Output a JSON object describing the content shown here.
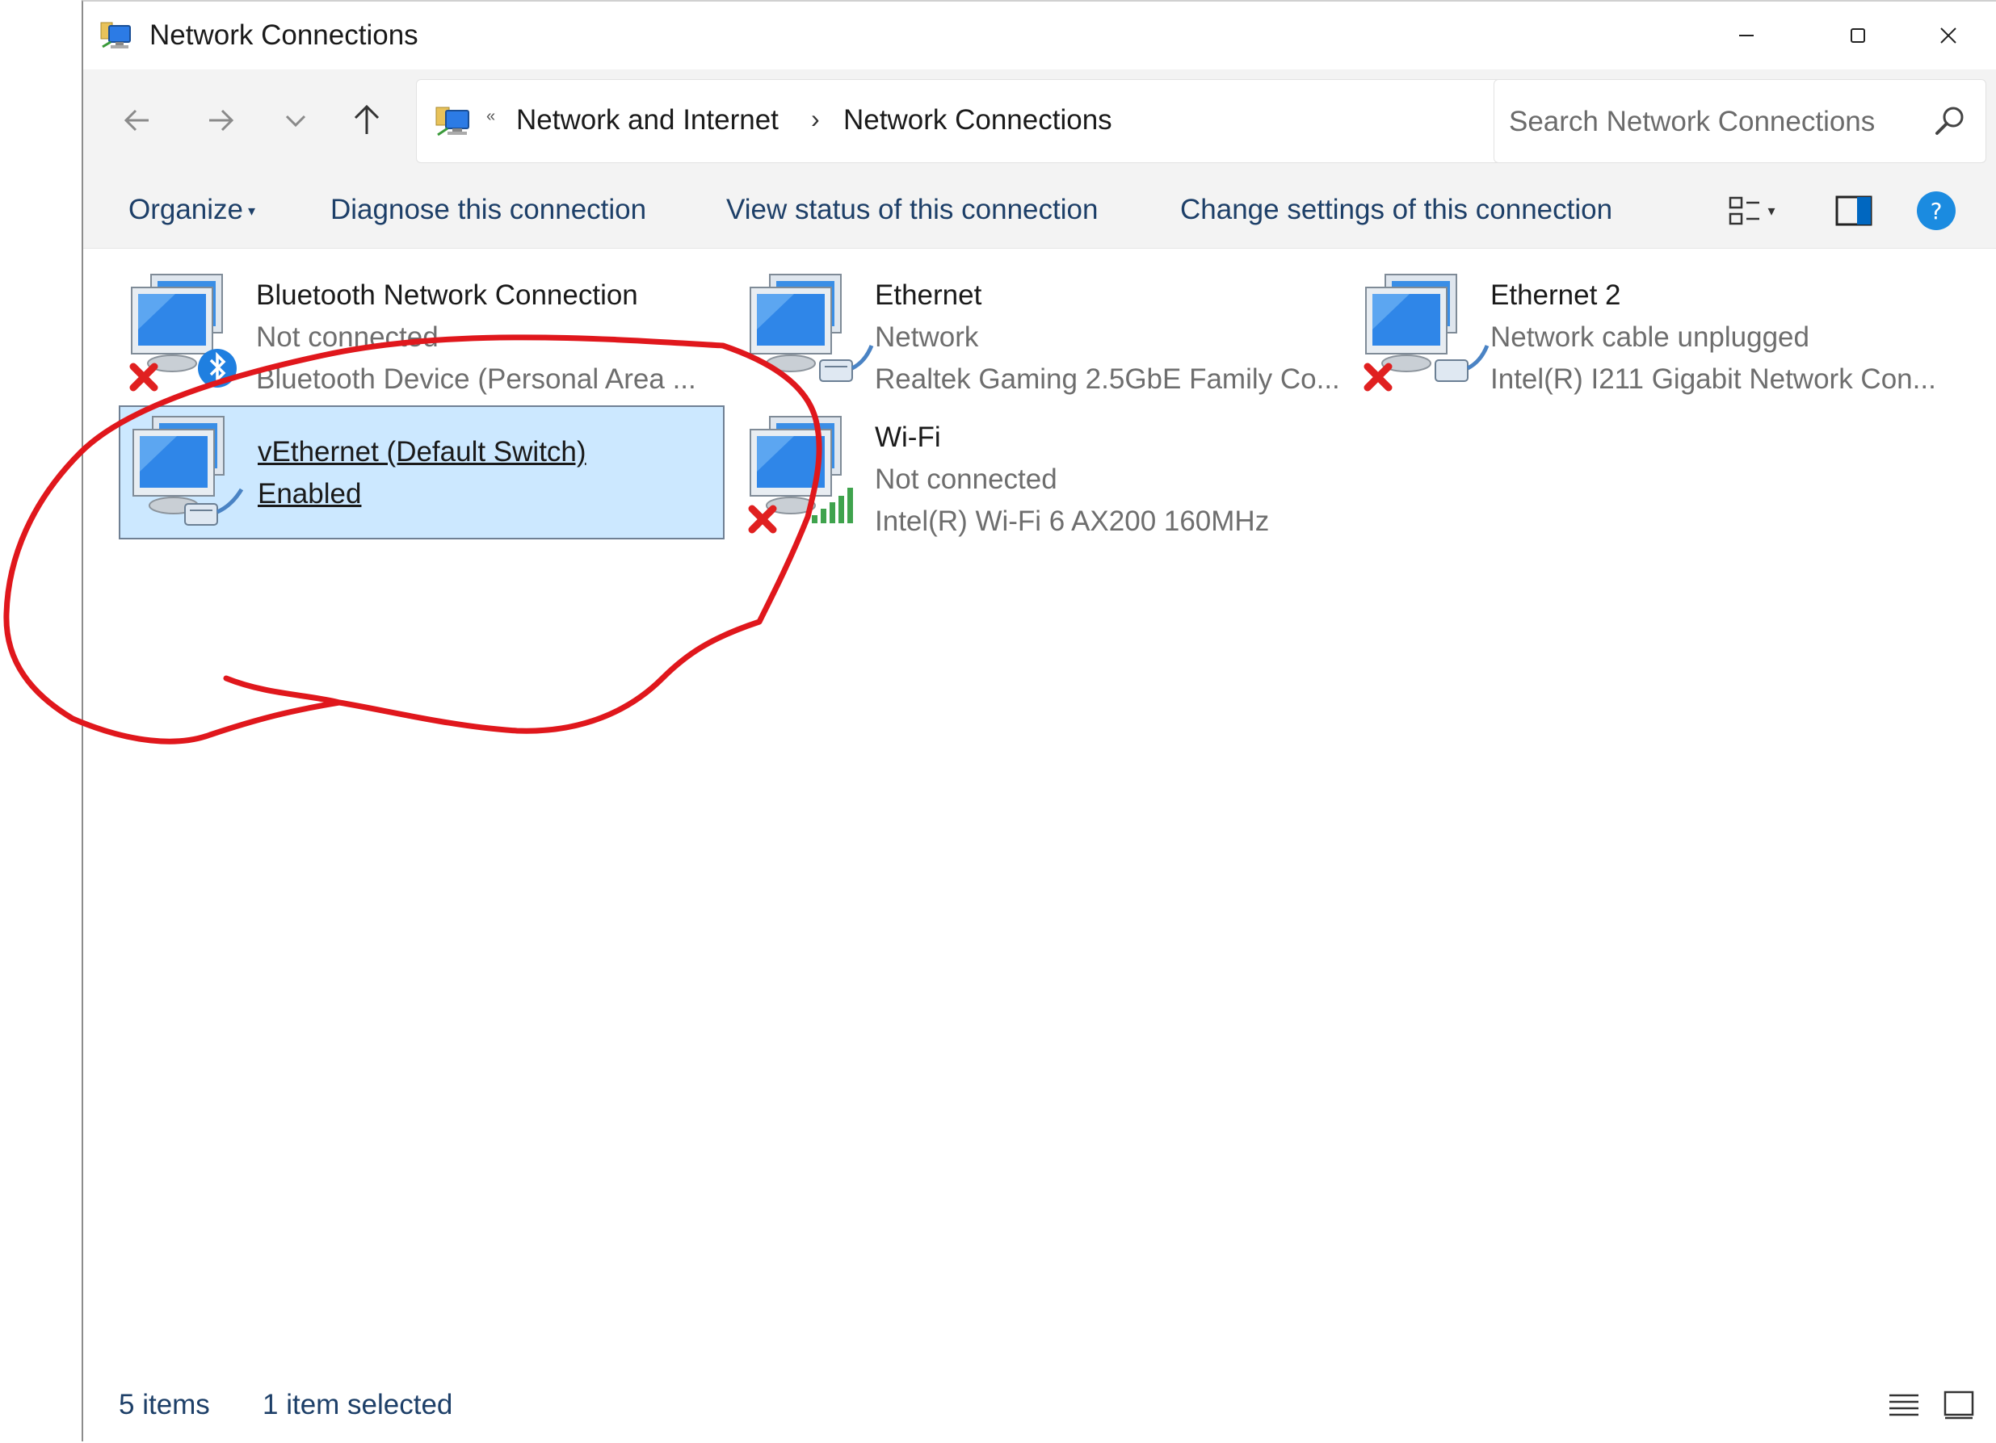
{
  "window": {
    "title": "Network Connections",
    "minimize_glyph": "—",
    "maximize_glyph": "☐",
    "close_glyph": "✕"
  },
  "address": {
    "crumbs": [
      "Network and Internet",
      "Network Connections"
    ],
    "separator": "«",
    "chevron": "›"
  },
  "search": {
    "placeholder": "Search Network Connections",
    "value": ""
  },
  "commands": {
    "organize": "Organize",
    "diagnose": "Diagnose this connection",
    "view_status": "View status of this connection",
    "change_settings": "Change settings of this connection"
  },
  "connections": [
    {
      "name": "Bluetooth Network Connection",
      "status": "Not connected",
      "device": "Bluetooth Device (Personal Area ...",
      "icon": "bluetooth-network-icon",
      "state": "disconnected"
    },
    {
      "name": "Ethernet",
      "status": "Network",
      "device": "Realtek Gaming 2.5GbE Family Co...",
      "icon": "ethernet-icon",
      "state": "connected"
    },
    {
      "name": "Ethernet 2",
      "status": "Network cable unplugged",
      "device": "Intel(R) I211 Gigabit Network Con...",
      "icon": "ethernet-icon",
      "state": "disconnected"
    },
    {
      "name": "vEthernet (Default Switch)",
      "status": "Enabled",
      "device": "",
      "icon": "ethernet-icon",
      "state": "connected",
      "selected": true
    },
    {
      "name": "Wi-Fi",
      "status": "Not connected",
      "device": "Intel(R) Wi-Fi 6 AX200 160MHz",
      "icon": "wifi-icon",
      "state": "disconnected"
    }
  ],
  "status": {
    "items": "5 items",
    "selected": "1 item selected"
  },
  "colors": {
    "accent": "#0067c0",
    "selection": "#cce8ff",
    "annotation": "#e0171c",
    "link_text": "#1d3f68"
  }
}
